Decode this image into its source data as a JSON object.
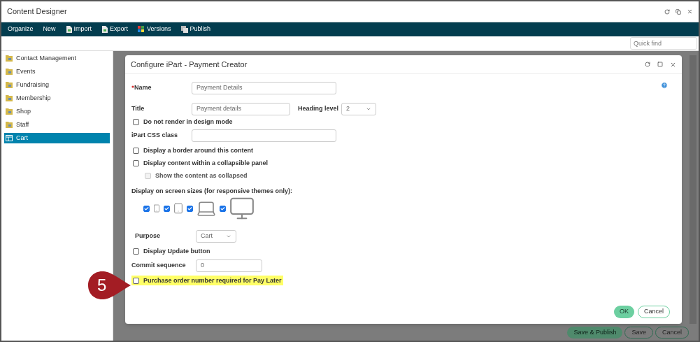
{
  "window": {
    "title": "Content Designer"
  },
  "nav": [
    {
      "label": "Organize",
      "kind": "text"
    },
    {
      "label": "New",
      "kind": "text"
    },
    {
      "label": "Import",
      "kind": "page"
    },
    {
      "label": "Export",
      "kind": "page"
    },
    {
      "label": "Versions",
      "kind": "grid"
    },
    {
      "label": "Publish",
      "kind": "stack"
    }
  ],
  "quick_find": {
    "placeholder": "Quick find"
  },
  "sidebar": {
    "items": [
      {
        "label": "Contact Management",
        "kind": "folder",
        "selected": false
      },
      {
        "label": "Events",
        "kind": "folder",
        "selected": false
      },
      {
        "label": "Fundraising",
        "kind": "folder",
        "selected": false
      },
      {
        "label": "Membership",
        "kind": "folder",
        "selected": false
      },
      {
        "label": "Shop",
        "kind": "folder",
        "selected": false
      },
      {
        "label": "Staff",
        "kind": "folder",
        "selected": false
      },
      {
        "label": "Cart",
        "kind": "page",
        "selected": true
      }
    ]
  },
  "modal": {
    "title": "Configure iPart - Payment Creator",
    "fields": [
      {
        "kind": "input",
        "label": "Name",
        "required": true,
        "value": "Payment Details"
      },
      {
        "kind": "input-select",
        "label": "Title",
        "required": false,
        "value": "Payment details",
        "select_label": "Heading level",
        "select_value": "2"
      },
      {
        "kind": "checkbox",
        "label": "Do not render in design mode",
        "checked": false,
        "disabled": false,
        "highlighted": false
      },
      {
        "kind": "input",
        "label": "iPart CSS class",
        "required": false
      },
      {
        "kind": "checkbox",
        "label": "Display a border around this content",
        "checked": false,
        "disabled": false,
        "highlighted": false
      },
      {
        "kind": "checkbox",
        "label": "Display content within a collapsible panel",
        "checked": false,
        "disabled": false,
        "highlighted": false,
        "children": [
          {
            "kind": "checkbox",
            "label": "Show the content as collapsed",
            "checked": false,
            "disabled": true,
            "highlighted": false
          }
        ]
      },
      {
        "kind": "heading",
        "label": "Display on screen sizes (for responsive themes only):"
      },
      {
        "kind": "devices",
        "devices": [
          {
            "kind": "phone",
            "checked": true
          },
          {
            "kind": "tablet",
            "checked": true
          },
          {
            "kind": "laptop",
            "checked": true
          },
          {
            "kind": "monitor",
            "checked": true
          }
        ]
      },
      {
        "kind": "select",
        "label": "Purpose",
        "value": "Cart"
      },
      {
        "kind": "checkbox",
        "label": "Display Update button",
        "checked": false,
        "disabled": false,
        "highlighted": false
      },
      {
        "kind": "number-input",
        "label": "Commit sequence",
        "required": false,
        "value": "0"
      },
      {
        "kind": "checkbox",
        "label": "Purchase order number required for Pay Later",
        "checked": false,
        "disabled": false,
        "highlighted": true
      }
    ],
    "buttons": [
      {
        "label": "OK",
        "kind": "primary"
      },
      {
        "label": "Cancel",
        "kind": "secondary"
      }
    ]
  },
  "background_buttons": [
    {
      "label": "Save & Publish",
      "kind": "primary"
    },
    {
      "label": "Save",
      "kind": "secondary"
    },
    {
      "label": "Cancel",
      "kind": "secondary"
    }
  ],
  "callout": {
    "number": "5"
  }
}
